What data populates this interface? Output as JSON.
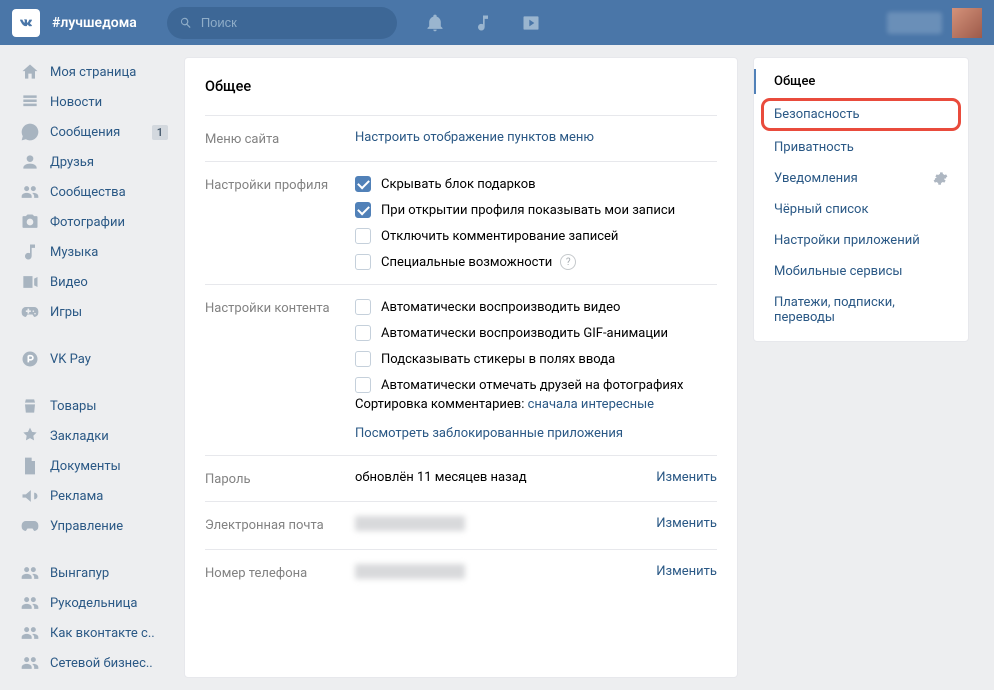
{
  "header": {
    "hashtag": "#лучшедома",
    "search_placeholder": "Поиск"
  },
  "sidebar": {
    "items": [
      {
        "label": "Моя страница",
        "icon": "home"
      },
      {
        "label": "Новости",
        "icon": "news"
      },
      {
        "label": "Сообщения",
        "icon": "messages",
        "badge": "1"
      },
      {
        "label": "Друзья",
        "icon": "friends"
      },
      {
        "label": "Сообщества",
        "icon": "communities"
      },
      {
        "label": "Фотографии",
        "icon": "photos"
      },
      {
        "label": "Музыка",
        "icon": "music"
      },
      {
        "label": "Видео",
        "icon": "video"
      },
      {
        "label": "Игры",
        "icon": "games"
      }
    ],
    "items2": [
      {
        "label": "VK Pay",
        "icon": "pay"
      }
    ],
    "items3": [
      {
        "label": "Товары",
        "icon": "market"
      },
      {
        "label": "Закладки",
        "icon": "bookmarks"
      },
      {
        "label": "Документы",
        "icon": "docs"
      },
      {
        "label": "Реклама",
        "icon": "ads"
      },
      {
        "label": "Управление",
        "icon": "manage"
      }
    ],
    "items4": [
      {
        "label": "Вынгапур",
        "icon": "group"
      },
      {
        "label": "Рукодельница",
        "icon": "group"
      },
      {
        "label": "Как вконтакте с..",
        "icon": "group"
      },
      {
        "label": "Сетевой бизнес..",
        "icon": "group"
      }
    ]
  },
  "settings": {
    "title": "Общее",
    "menu": {
      "label": "Меню сайта",
      "link": "Настроить отображение пунктов меню"
    },
    "profile": {
      "label": "Настройки профиля",
      "options": [
        {
          "text": "Скрывать блок подарков",
          "checked": true
        },
        {
          "text": "При открытии профиля показывать мои записи",
          "checked": true
        },
        {
          "text": "Отключить комментирование записей",
          "checked": false
        },
        {
          "text": "Специальные возможности",
          "checked": false,
          "help": true
        }
      ]
    },
    "content": {
      "label": "Настройки контента",
      "options": [
        {
          "text": "Автоматически воспроизводить видео",
          "checked": false
        },
        {
          "text": "Автоматически воспроизводить GIF-анимации",
          "checked": false
        },
        {
          "text": "Подсказывать стикеры в полях ввода",
          "checked": false
        },
        {
          "text": "Автоматически отмечать друзей на фотографиях",
          "checked": false
        }
      ],
      "sort_label": "Сортировка комментариев: ",
      "sort_value": "сначала интересные",
      "blocked_link": "Посмотреть заблокированные приложения"
    },
    "password": {
      "label": "Пароль",
      "value": "обновлён 11 месяцев назад",
      "action": "Изменить"
    },
    "email": {
      "label": "Электронная почта",
      "action": "Изменить"
    },
    "phone": {
      "label": "Номер телефона",
      "action": "Изменить"
    }
  },
  "right_menu": {
    "items": [
      {
        "label": "Общее",
        "active": true
      },
      {
        "label": "Безопасность",
        "highlighted": true
      },
      {
        "label": "Приватность"
      },
      {
        "label": "Уведомления",
        "gear": true
      },
      {
        "label": "Чёрный список"
      },
      {
        "label": "Настройки приложений"
      },
      {
        "label": "Мобильные сервисы"
      },
      {
        "label": "Платежи, подписки, переводы"
      }
    ]
  }
}
